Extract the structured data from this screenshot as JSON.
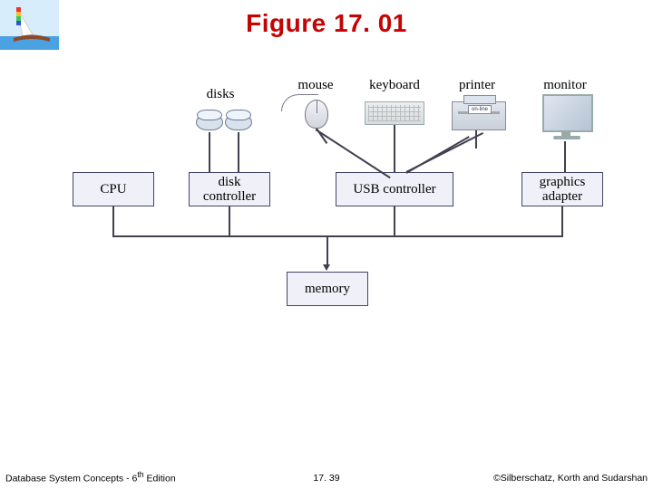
{
  "title": "Figure 17. 01",
  "devices": {
    "disks": "disks",
    "mouse": "mouse",
    "keyboard": "keyboard",
    "printer": "printer",
    "monitor": "monitor",
    "printer_badge": "on-line"
  },
  "controllers": {
    "cpu": "CPU",
    "disk": "disk\ncontroller",
    "usb": "USB controller",
    "graphics": "graphics\nadapter",
    "memory": "memory"
  },
  "footer": {
    "left_a": "Database System Concepts - 6",
    "left_sup": "th",
    "left_b": " Edition",
    "mid": "17. 39",
    "right": "©Silberschatz, Korth and Sudarshan"
  }
}
